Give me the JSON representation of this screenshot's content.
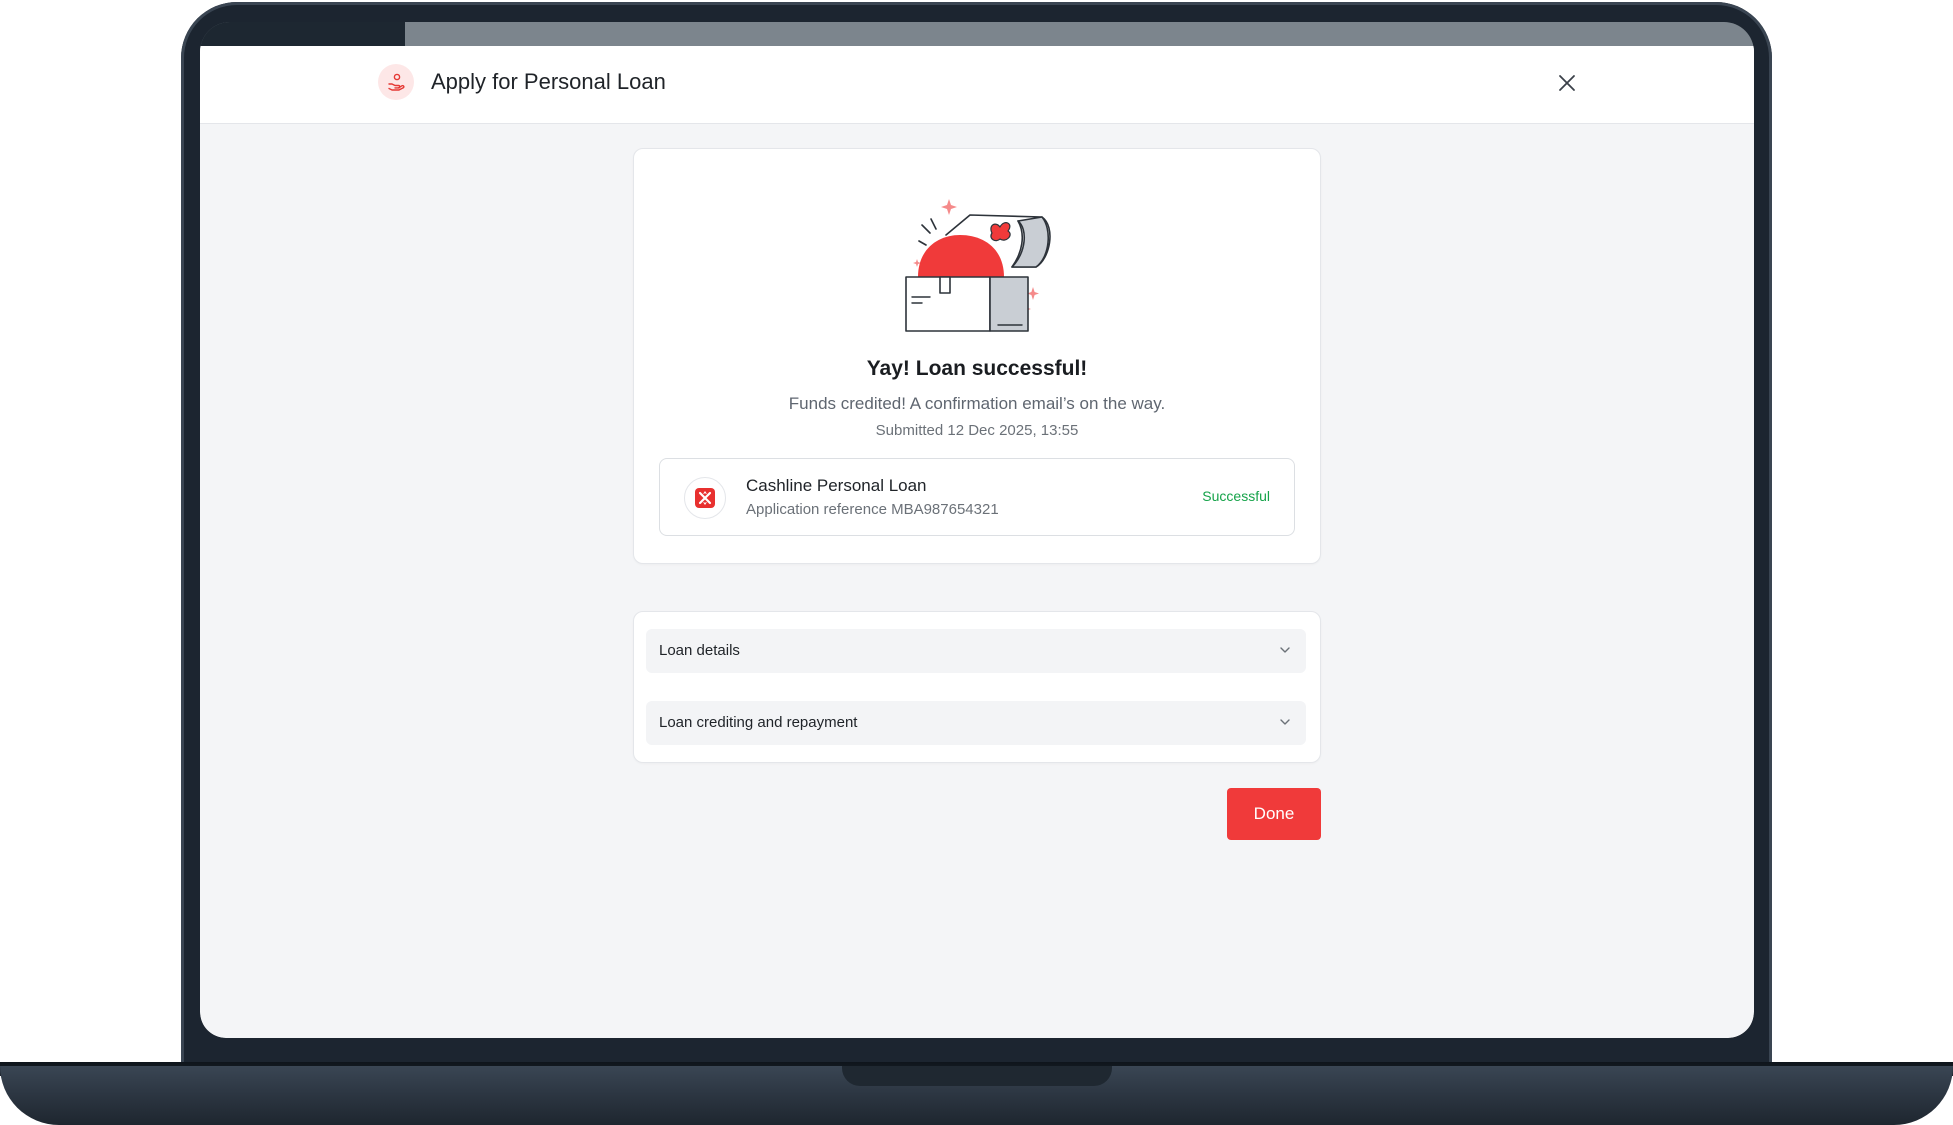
{
  "header": {
    "title": "Apply for Personal Loan"
  },
  "progress": {
    "fraction": 0.132
  },
  "success": {
    "title": "Yay! Loan successful!",
    "subtitle": "Funds credited! A confirmation email’s on the way.",
    "submitted": "Submitted 12 Dec 2025, 13:55"
  },
  "loan": {
    "name": "Cashline Personal Loan",
    "reference": "Application reference MBA987654321",
    "status": "Successful"
  },
  "accordion": [
    {
      "label": "Loan details"
    },
    {
      "label": "Loan crediting and repayment"
    }
  ],
  "actions": {
    "done_label": "Done"
  },
  "colors": {
    "brand_red": "#f03a3a",
    "success_green": "#16a34a",
    "background": "#f4f5f7"
  },
  "icons": {
    "header": "hand-coin-icon",
    "close": "close-icon",
    "loan": "bank-logo-icon",
    "chevron": "chevron-down-icon",
    "illustration": "treasure-chest-illustration"
  }
}
